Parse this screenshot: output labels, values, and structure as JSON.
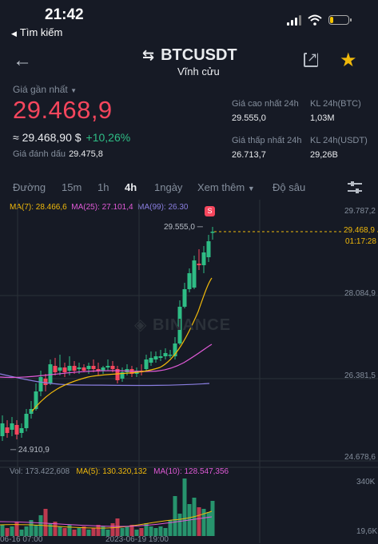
{
  "status": {
    "time": "21:42",
    "back_label": "Tìm kiếm"
  },
  "header": {
    "pair": "BTCUSDT",
    "subtitle": "Vĩnh cửu"
  },
  "ticker": {
    "last_label": "Giá gần nhất",
    "last_price": "29.468,9",
    "usd_value": "≈ 29.468,90 $",
    "change": "+10,26%",
    "mark_label": "Giá đánh dấu",
    "mark_value": "29.475,8"
  },
  "stats": {
    "high_label": "Giá cao nhất 24h",
    "high_value": "29.555,0",
    "vol_btc_label": "KL 24h(BTC)",
    "vol_btc_value": "1,03M",
    "low_label": "Giá thấp nhất 24h",
    "low_value": "26.713,7",
    "vol_usdt_label": "KL 24h(USDT)",
    "vol_usdt_value": "29,26B"
  },
  "tabs": [
    "Đường",
    "15m",
    "1h",
    "4h",
    "1ngày",
    "Xem thêm",
    "Độ sâu"
  ],
  "active_tab": "4h",
  "indicators": {
    "ma7": "MA(7): 28.466,6",
    "ma25": "MA(25): 27.101,4",
    "ma99": "MA(99): 26.30"
  },
  "price_axis": [
    "29.787,2",
    "28.084,9",
    "26.381,5",
    "24.678,6"
  ],
  "current_price_tag": "29.468,9",
  "countdown": "01:17:28",
  "high_marker": "29.555,0",
  "low_marker": "24.910,9",
  "signal_badge": "S",
  "watermark": "BINANCE",
  "volume": {
    "vol": "Vol: 173.422,608",
    "ma5": "MA(5): 130.320,132",
    "ma10": "MA(10): 128.547,356",
    "axis_top": "340K",
    "axis_bottom": "19,6K"
  },
  "time_axis": [
    "06-16 07:00",
    "2023-06-19 19:00"
  ],
  "colors": {
    "up": "#2ebd85",
    "down": "#f6465d",
    "ma7": "#f0b90b",
    "ma25": "#e05ad7",
    "ma99": "#8a7ee0",
    "bg": "#161a25"
  }
}
